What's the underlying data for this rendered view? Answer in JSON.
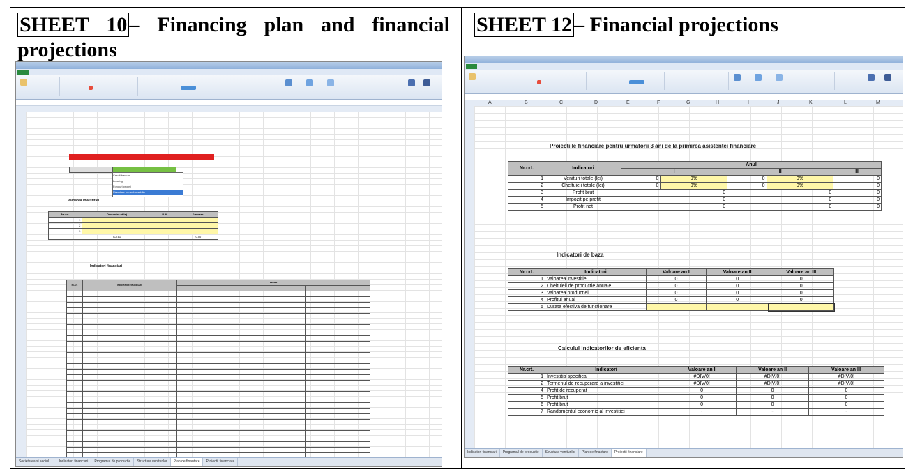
{
  "headings": {
    "left": {
      "boxed": "SHEET 10",
      "rest_line1": "– Financing plan and financial",
      "line2": "projections"
    },
    "right": {
      "boxed": "SHEET 12",
      "rest": "– Financial projections"
    }
  },
  "right_sheet": {
    "title": "Proiectiile financiare pentru urmatorii 3 ani de la primirea asistentei financiare",
    "columns": [
      "A",
      "B",
      "C",
      "D",
      "E",
      "F",
      "G",
      "H",
      "I",
      "J",
      "K",
      "L",
      "M"
    ],
    "table1": {
      "headers": [
        "Nr.crt.",
        "Indicatori",
        "Anul"
      ],
      "years": [
        "I",
        "II",
        "III"
      ],
      "rows": [
        {
          "nr": "1",
          "name": "Venituri totale (lei)",
          "v1": "0",
          "p1": "0%",
          "v2": "0",
          "p2": "0%",
          "v3": "0"
        },
        {
          "nr": "2",
          "name": "Cheltuieli totale (lei)",
          "v1": "0",
          "p1": "0%",
          "v2": "0",
          "p2": "0%",
          "v3": "0"
        },
        {
          "nr": "3",
          "name": "Profit brut",
          "v1": "0",
          "p1": "",
          "v2": "0",
          "p2": "",
          "v3": "0"
        },
        {
          "nr": "4",
          "name": "Impozit pe profit",
          "v1": "0",
          "p1": "",
          "v2": "0",
          "p2": "",
          "v3": "0"
        },
        {
          "nr": "5",
          "name": "Profit net",
          "v1": "0",
          "p1": "",
          "v2": "0",
          "p2": "",
          "v3": "0"
        }
      ]
    },
    "table2": {
      "caption": "Indicatori de baza",
      "headers": [
        "Nr crt.",
        "Indicatori",
        "Valoare an I",
        "Valoare an II",
        "Valoare an III"
      ],
      "rows": [
        {
          "nr": "1",
          "name": "Valoarea investitiei",
          "a": "0",
          "b": "0",
          "c": "0"
        },
        {
          "nr": "2",
          "name": "Cheltuieli de productie anuale",
          "a": "0",
          "b": "0",
          "c": "0"
        },
        {
          "nr": "3",
          "name": "Valoarea productiei",
          "a": "0",
          "b": "0",
          "c": "0"
        },
        {
          "nr": "4",
          "name": "Profitul anual",
          "a": "0",
          "b": "0",
          "c": "0"
        },
        {
          "nr": "5",
          "name": "Durata efectiva de functionare",
          "a": "",
          "b": "",
          "c": ""
        }
      ]
    },
    "table3": {
      "caption": "Calculul indicatorilor de eficienta",
      "headers": [
        "Nr.crt.",
        "Indicatori",
        "Valoare an I",
        "Valoare an II",
        "Valoare an III"
      ],
      "rows": [
        {
          "nr": "1",
          "name": "Investitia specifica",
          "a": "#DIV/0!",
          "b": "#DIV/0!",
          "c": "#DIV/0!"
        },
        {
          "nr": "2",
          "name": "Termenul de recuperare a investitiei",
          "a": "#DIV/0!",
          "b": "#DIV/0!",
          "c": "#DIV/0!"
        },
        {
          "nr": "4",
          "name": "Profit de recuperat",
          "a": "0",
          "b": "0",
          "c": "0"
        },
        {
          "nr": "5",
          "name": "Profit brut",
          "a": "0",
          "b": "0",
          "c": "0"
        },
        {
          "nr": "6",
          "name": "Profit brut",
          "a": "0",
          "b": "0",
          "c": "0"
        },
        {
          "nr": "7",
          "name": "Randamentul economic al investitiei",
          "a": "-",
          "b": "-",
          "c": "-"
        }
      ]
    }
  },
  "left_sheet": {
    "caption_values": "Valoarea investitiei",
    "caption_indicators": "Indicatori financiari",
    "dropdown_options": [
      "Credit bancar",
      "Leasing",
      "Fonduri proprii",
      "Finantare nerambursabila"
    ],
    "inv_headers": [
      "Nr.crt.",
      "Denumire utilaj",
      "U.M.",
      "Valoare"
    ],
    "inv_total": "TOTAL",
    "inv_total_value": "0.00",
    "ind_headers": [
      "Nr.crt.",
      "INDICATORI FINANCIARI",
      "Valoare"
    ],
    "ind_rows": 36,
    "tabs": [
      "Societatea si sediul ...",
      "Indicatori financiari",
      "Programul de productie",
      "Structura veniturilor",
      "Plan de finantare",
      "Proiectii financiare"
    ]
  }
}
